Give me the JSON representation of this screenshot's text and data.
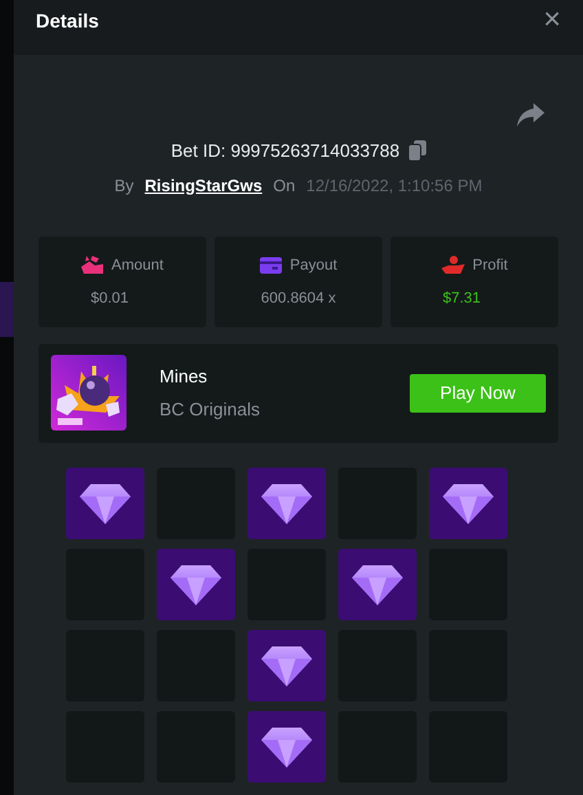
{
  "window": {
    "title": "Details",
    "close": "×"
  },
  "bet": {
    "id_label": "Bet ID: 99975263714033788",
    "by_label": "By",
    "user": "RisingStarGws",
    "on_label": "On",
    "date": "12/16/2022, 1:10:56 PM"
  },
  "stats": [
    {
      "kind": "amount",
      "label": "Amount",
      "value": "$0.01",
      "positive": false
    },
    {
      "kind": "payout",
      "label": "Payout",
      "value": "600.8604 x",
      "positive": false
    },
    {
      "kind": "profit",
      "label": "Profit",
      "value": "$7.31",
      "positive": true
    }
  ],
  "game": {
    "name": "Mines",
    "provider": "BC Originals",
    "button": "Play Now"
  },
  "board": [
    [
      {
        "gem": true
      },
      {
        "gem": false
      },
      {
        "gem": true
      },
      {
        "gem": false
      },
      {
        "gem": true
      }
    ],
    [
      {
        "gem": false
      },
      {
        "gem": true
      },
      {
        "gem": false
      },
      {
        "gem": true
      },
      {
        "gem": false
      }
    ],
    [
      {
        "gem": false
      },
      {
        "gem": false
      },
      {
        "gem": true
      },
      {
        "gem": false
      },
      {
        "gem": false
      }
    ],
    [
      {
        "gem": false
      },
      {
        "gem": false
      },
      {
        "gem": true
      },
      {
        "gem": false
      },
      {
        "gem": false
      }
    ]
  ]
}
